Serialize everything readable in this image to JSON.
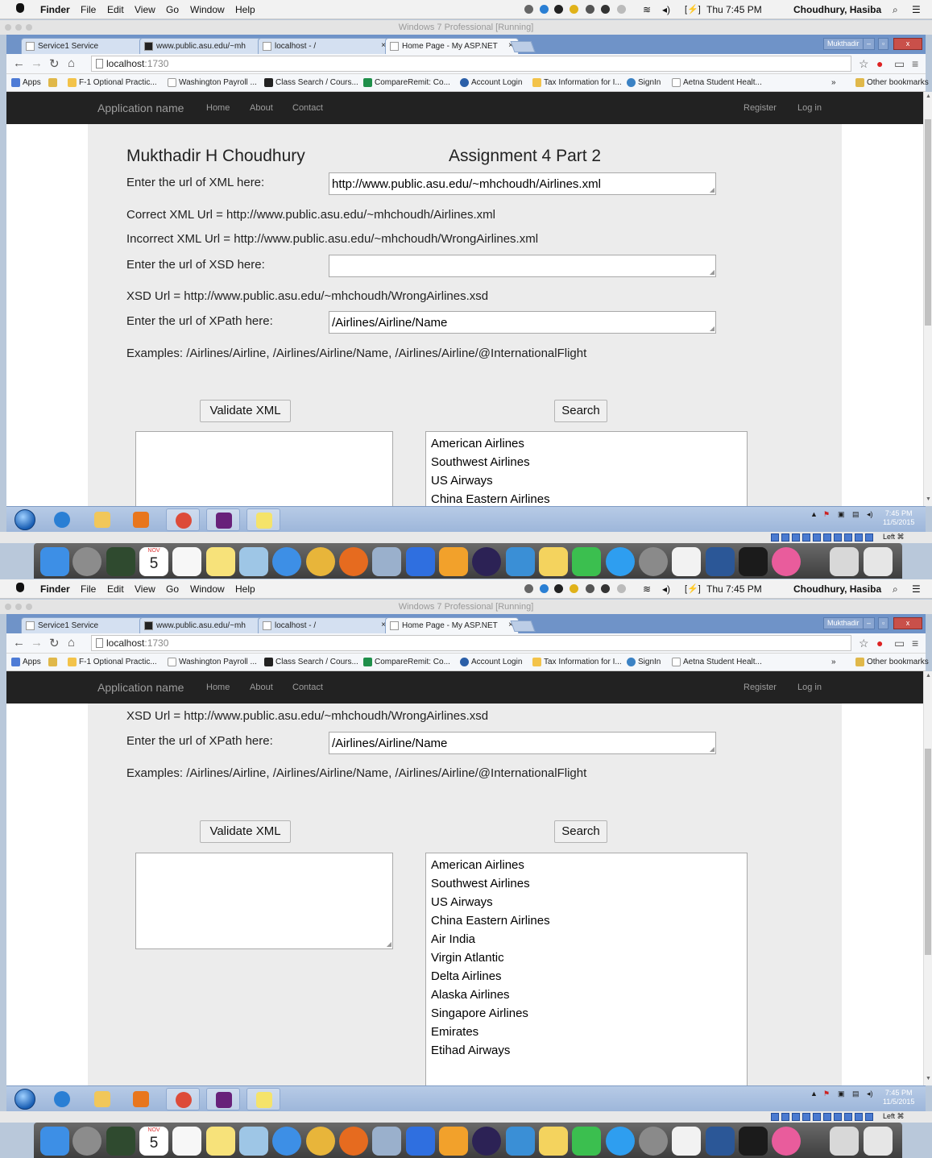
{
  "mac_menu": {
    "items": [
      "Finder",
      "File",
      "Edit",
      "View",
      "Go",
      "Window",
      "Help"
    ],
    "clock": "Thu 7:45 PM",
    "user": "Choudhury, Hasiba"
  },
  "vm": {
    "title": "Windows 7 Professional [Running]",
    "status_key": "Left ⌘"
  },
  "browser": {
    "tabs": [
      {
        "label": "Service1 Service",
        "active": false
      },
      {
        "label": "www.public.asu.edu/~mh",
        "active": false
      },
      {
        "label": "localhost - /",
        "active": false
      },
      {
        "label": "Home Page - My ASP.NET",
        "active": true
      }
    ],
    "tab_close": "×",
    "profile_badge": "Mukthadir",
    "window_controls": [
      "–",
      "▫",
      "x"
    ],
    "url_host": "localhost",
    "url_port": ":1730",
    "bookmarks": [
      {
        "label": "Apps",
        "color": "#4d7bd6"
      },
      {
        "label": "",
        "color": "#e0b84a"
      },
      {
        "label": "F-1 Optional Practic...",
        "color": "#f3c34a"
      },
      {
        "label": "Washington Payroll ...",
        "color": "#ffffff"
      },
      {
        "label": "Class Search / Cours...",
        "color": "#222222"
      },
      {
        "label": "CompareRemit: Co...",
        "color": "#1f8f4a"
      },
      {
        "label": "Account Login",
        "color": "#2b5fa8"
      },
      {
        "label": "Tax Information for I...",
        "color": "#f3c34a"
      },
      {
        "label": "SignIn",
        "color": "#3b82c4"
      },
      {
        "label": "Aetna Student Healt...",
        "color": "#ffffff"
      }
    ],
    "bookmarks_overflow": "»",
    "other_bookmarks": "Other bookmarks"
  },
  "site_nav": {
    "brand": "Application name",
    "links": [
      "Home",
      "About",
      "Contact"
    ],
    "right_links": [
      "Register",
      "Log in"
    ]
  },
  "form": {
    "author": "Mukthadir H Choudhury",
    "assignment": "Assignment 4 Part 2",
    "xml_label": "Enter the url of XML here:",
    "xml_value": "http://www.public.asu.edu/~mhchoudh/Airlines.xml",
    "correct_xml": "Correct XML Url = http://www.public.asu.edu/~mhchoudh/Airlines.xml",
    "incorrect_xml": "Incorrect XML Url = http://www.public.asu.edu/~mhchoudh/WrongAirlines.xml",
    "xsd_label": "Enter the url of XSD here:",
    "xsd_value": "",
    "xsd_url": "XSD Url = http://www.public.asu.edu/~mhchoudh/WrongAirlines.xsd",
    "xpath_label": "Enter the url of XPath here:",
    "xpath_value": "/Airlines/Airline/Name",
    "examples": "Examples: /Airlines/Airline, /Airlines/Airline/Name, /Airlines/Airline/@InternationalFlight",
    "validate_button": "Validate XML",
    "search_button": "Search",
    "validation_output": "",
    "results": [
      "American Airlines",
      "Southwest Airlines",
      "US Airways",
      "China Eastern Airlines",
      "Air India",
      "Virgin Atlantic",
      "Delta Airlines",
      "Alaska Airlines",
      "Singapore Airlines",
      "Emirates",
      "Etihad Airways"
    ]
  },
  "taskbar": {
    "clock_time": "7:45 PM",
    "clock_date": "11/5/2015",
    "apps": [
      {
        "name": "internet-explorer",
        "color": "#2a7fd4"
      },
      {
        "name": "windows-explorer",
        "color": "#f1c75a"
      },
      {
        "name": "media-player",
        "color": "#e8761d"
      },
      {
        "name": "chrome",
        "color": "#dd4b39"
      },
      {
        "name": "visual-studio",
        "color": "#68217a"
      },
      {
        "name": "sticky-folder",
        "color": "#f5e36a"
      }
    ]
  },
  "dock": {
    "calendar_month": "NOV",
    "calendar_day": "5",
    "apps": [
      {
        "name": "finder",
        "color": "#3d8fe6"
      },
      {
        "name": "launchpad",
        "color": "#8c8c8c"
      },
      {
        "name": "mission-control",
        "color": "#2f4a2f"
      },
      {
        "name": "calendar",
        "color": "#ffffff"
      },
      {
        "name": "reminders",
        "color": "#f7f7f7"
      },
      {
        "name": "notes",
        "color": "#f7e27a"
      },
      {
        "name": "preview",
        "color": "#9ec6e6"
      },
      {
        "name": "safari",
        "color": "#3d8fe6"
      },
      {
        "name": "chrome",
        "color": "#e8b53a"
      },
      {
        "name": "firefox",
        "color": "#e66b1f"
      },
      {
        "name": "virtualbox",
        "color": "#9ab0cc"
      },
      {
        "name": "intellij",
        "color": "#2f6fe0"
      },
      {
        "name": "eclipse-ide",
        "color": "#f2a12b"
      },
      {
        "name": "eclipse",
        "color": "#2c2255"
      },
      {
        "name": "xcode",
        "color": "#3a8fd6"
      },
      {
        "name": "python-launcher",
        "color": "#f4d35e"
      },
      {
        "name": "facetime",
        "color": "#3bbf4f"
      },
      {
        "name": "app-store",
        "color": "#2e9ef0"
      },
      {
        "name": "system-preferences",
        "color": "#8a8a8a"
      },
      {
        "name": "textedit",
        "color": "#f2f2f2"
      },
      {
        "name": "word",
        "color": "#2b5797"
      },
      {
        "name": "virtual-machine",
        "color": "#1b1b1b"
      },
      {
        "name": "itunes",
        "color": "#e95c9c"
      },
      {
        "name": "documents",
        "color": "#d8d8d8"
      },
      {
        "name": "trash",
        "color": "#e6e6e6"
      }
    ]
  }
}
